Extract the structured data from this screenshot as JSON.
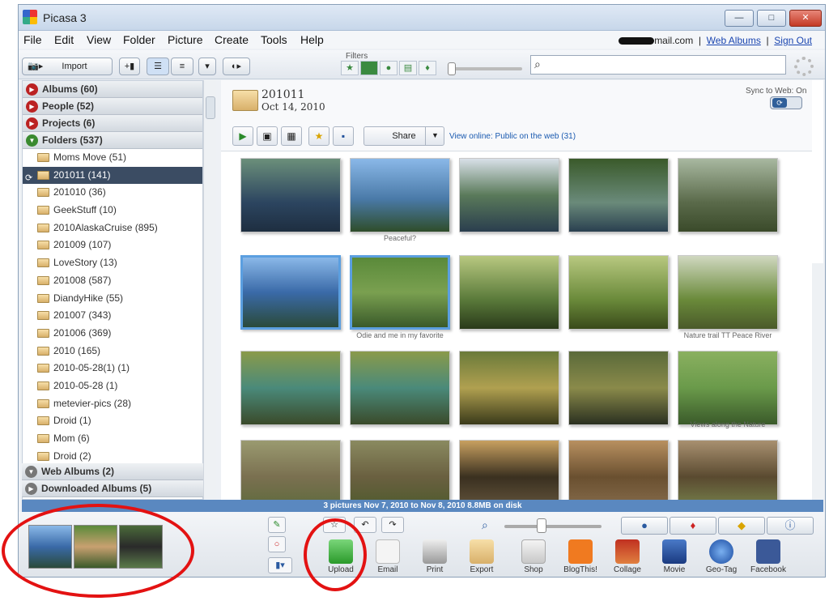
{
  "window": {
    "title": "Picasa 3",
    "min": "—",
    "max": "□",
    "close": "✕"
  },
  "menu": [
    "File",
    "Edit",
    "View",
    "Folder",
    "Picture",
    "Create",
    "Tools",
    "Help"
  ],
  "account": {
    "email_suffix": "mail.com",
    "web_albums": "Web Albums",
    "sign_out": "Sign Out",
    "sep": "|"
  },
  "toolbar": {
    "import": "Import",
    "filters_label": "Filters"
  },
  "search": {
    "placeholder": ""
  },
  "sidebar": {
    "sections": [
      {
        "label": "Albums (60)"
      },
      {
        "label": "People (52)"
      },
      {
        "label": "Projects (6)"
      },
      {
        "label": "Folders (537)"
      }
    ],
    "folders": [
      {
        "label": "Moms Move (51)"
      },
      {
        "label": "201011 (141)",
        "selected": true
      },
      {
        "label": "201010 (36)"
      },
      {
        "label": "GeekStuff (10)"
      },
      {
        "label": "2010AlaskaCruise (895)"
      },
      {
        "label": "201009 (107)"
      },
      {
        "label": "LoveStory (13)"
      },
      {
        "label": "201008 (587)"
      },
      {
        "label": "DiandyHike (55)"
      },
      {
        "label": "201007 (343)"
      },
      {
        "label": "201006 (369)"
      },
      {
        "label": "2010 (165)"
      },
      {
        "label": "2010-05-28(1) (1)"
      },
      {
        "label": "2010-05-28 (1)"
      },
      {
        "label": "metevier-pics (28)"
      },
      {
        "label": "Droid (1)"
      },
      {
        "label": "Mom (6)"
      },
      {
        "label": "Droid (2)"
      }
    ],
    "footer_sections": [
      {
        "label": "Web Albums (2)"
      },
      {
        "label": "Downloaded Albums (5)"
      }
    ]
  },
  "album": {
    "name": "201011",
    "date": "Oct 14, 2010",
    "sync_label": "Sync to Web: On",
    "share": "Share",
    "view_online": "View online: Public on the web (31)"
  },
  "captions": {
    "peaceful": "Peaceful?",
    "odie": "Odie and me in my favorite",
    "nature_trail": "Nature trail TT Peace River",
    "views": "Views along the Nature"
  },
  "status": {
    "text": "3 pictures     Nov 7, 2010 to Nov 8, 2010     8.8MB on disk"
  },
  "actions": [
    {
      "label": "Upload",
      "icon": "upload-arrow-icon"
    },
    {
      "label": "Email",
      "icon": "envelope-icon"
    },
    {
      "label": "Print",
      "icon": "printer-icon"
    },
    {
      "label": "Export",
      "icon": "folder-icon"
    },
    {
      "label": "Shop",
      "icon": "shop-icon"
    },
    {
      "label": "BlogThis!",
      "icon": "blogger-icon"
    },
    {
      "label": "Collage",
      "icon": "collage-icon"
    },
    {
      "label": "Movie",
      "icon": "film-icon"
    },
    {
      "label": "Geo-Tag",
      "icon": "globe-icon"
    },
    {
      "label": "Facebook",
      "icon": "facebook-icon"
    }
  ],
  "colors": {
    "accent": "#5a88c0",
    "selection": "#3b4c63",
    "annotation": "#e31212"
  }
}
